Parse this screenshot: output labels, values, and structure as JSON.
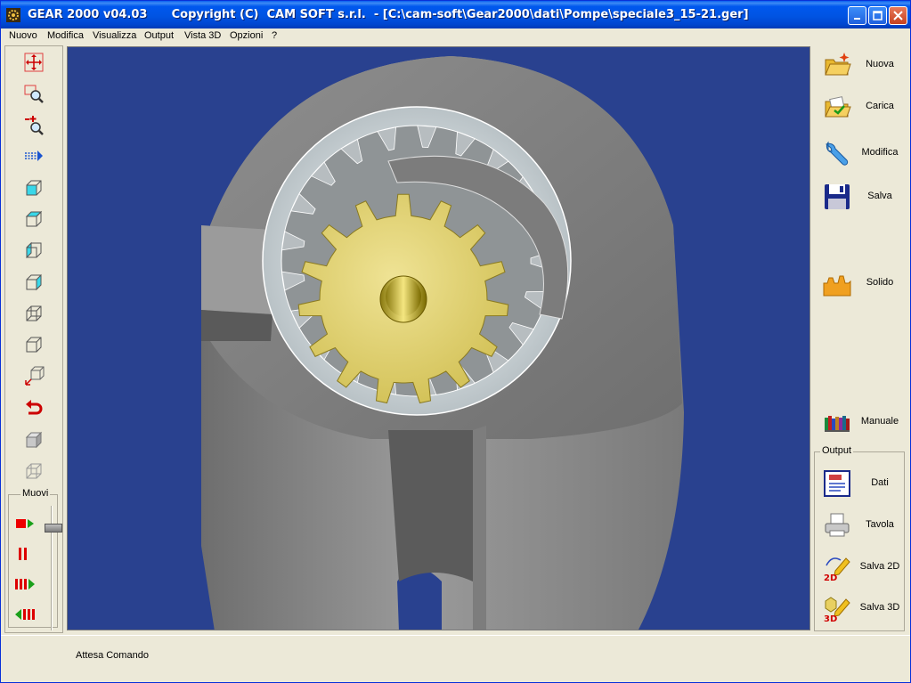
{
  "window": {
    "title": "GEAR 2000 v04.03      Copyright (C)  CAM SOFT s.r.l.  - [C:\\cam-soft\\Gear2000\\dati\\Pompe\\speciale3_15-21.ger]",
    "icon": "gear-app-icon"
  },
  "menu": {
    "items": [
      "Nuovo",
      "Modifica",
      "Visualizza",
      "Output",
      "Vista 3D",
      "Opzioni",
      "?"
    ]
  },
  "left_toolbar": {
    "tools": [
      {
        "name": "pan-icon"
      },
      {
        "name": "zoom-window-icon"
      },
      {
        "name": "zoom-in-out-icon"
      },
      {
        "name": "move-right-icon"
      },
      {
        "name": "view-cube-front-icon"
      },
      {
        "name": "view-cube-top-icon"
      },
      {
        "name": "view-cube-left-icon"
      },
      {
        "name": "view-cube-right-icon"
      },
      {
        "name": "view-cube-wire-icon"
      },
      {
        "name": "view-cube-iso-icon"
      },
      {
        "name": "axes-cube-icon"
      },
      {
        "name": "rotate-back-icon"
      },
      {
        "name": "solid-box-icon"
      },
      {
        "name": "wire-box-icon"
      }
    ],
    "muovi": {
      "label": "Muovi",
      "controls": [
        "play-icon",
        "pause-icon",
        "fast-forward-icon",
        "rewind-icon"
      ]
    }
  },
  "right_panel": {
    "buttons": [
      {
        "label": "Nuova",
        "icon": "new-folder-icon"
      },
      {
        "label": "Carica",
        "icon": "open-folder-icon"
      },
      {
        "label": "Modifica",
        "icon": "wrench-icon"
      },
      {
        "label": "Salva",
        "icon": "floppy-disk-icon"
      },
      {
        "label": "Solido",
        "icon": "solid-gear-icon"
      },
      {
        "label": "Manuale",
        "icon": "books-icon"
      }
    ],
    "output": {
      "label": "Output",
      "buttons": [
        {
          "label": "Dati",
          "icon": "data-document-icon"
        },
        {
          "label": "Tavola",
          "icon": "printer-icon"
        },
        {
          "label": "Salva 2D",
          "icon": "save-2d-pencil-icon"
        },
        {
          "label": "Salva 3D",
          "icon": "save-3d-pencil-icon"
        }
      ]
    }
  },
  "status": {
    "text": "Attesa Comando"
  },
  "colors": {
    "viewport_bg": "#29418f",
    "housing": "#8f8f8f",
    "gear": "#e2d26a",
    "titlebar": "#0054e3"
  }
}
